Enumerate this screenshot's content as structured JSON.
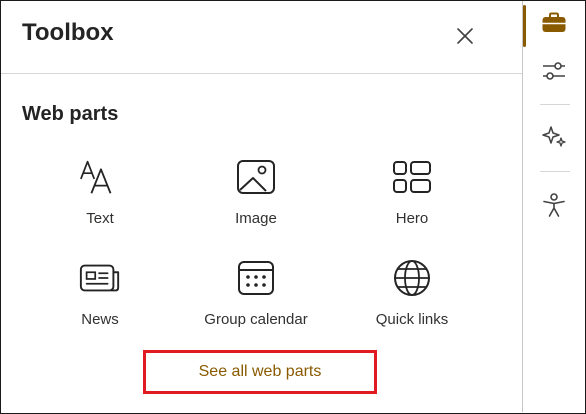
{
  "panel": {
    "title": "Toolbox",
    "close_icon": "close-icon"
  },
  "web_parts": {
    "heading": "Web parts",
    "items": [
      {
        "label": "Text",
        "icon": "text-icon"
      },
      {
        "label": "Image",
        "icon": "image-icon"
      },
      {
        "label": "Hero",
        "icon": "hero-icon"
      },
      {
        "label": "News",
        "icon": "news-icon"
      },
      {
        "label": "Group calendar",
        "icon": "calendar-icon"
      },
      {
        "label": "Quick links",
        "icon": "globe-icon"
      }
    ],
    "see_all_label": "See all web parts"
  },
  "rail": {
    "items": [
      {
        "icon": "toolbox-icon",
        "active": true
      },
      {
        "icon": "sliders-icon",
        "active": false
      },
      {
        "icon": "sparkle-icon",
        "active": false
      },
      {
        "icon": "accessibility-icon",
        "active": false
      }
    ]
  },
  "colors": {
    "accent": "#8a5a00",
    "highlight_border": "#e11b22",
    "text": "#242424",
    "divider": "#d6d6d6"
  }
}
